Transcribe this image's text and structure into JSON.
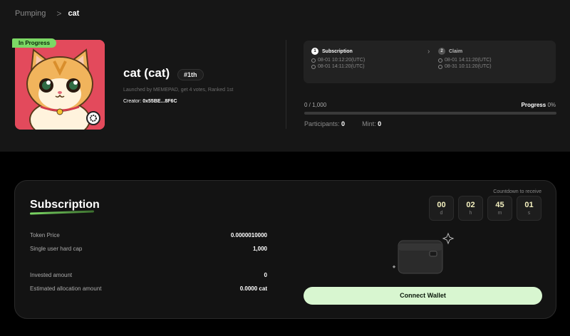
{
  "breadcrumb": {
    "parent": "Pumping",
    "separator": ">",
    "current": "cat"
  },
  "token": {
    "status_badge": "In Progress",
    "title": "cat (cat)",
    "rank": "#1th",
    "launched_text": "Launched by MEMEPAD, get 4 votes, Ranked 1st",
    "creator_label": "Creator:",
    "creator_address": "0x55BE...8F6C"
  },
  "steps": [
    {
      "num": "1",
      "label": "Subscription",
      "start": "08-01 10:12:20(UTC)",
      "end": "08-01 14:11:20(UTC)",
      "active": true
    },
    {
      "num": "2",
      "label": "Claim",
      "start": "08-01 14:11:20(UTC)",
      "end": "08-31 10:11:20(UTC)",
      "active": false
    }
  ],
  "progress": {
    "amount_text": "0 / 1,000",
    "label": "Progress",
    "percent_text": "0%",
    "percent": 0,
    "participants_label": "Participants:",
    "participants": "0",
    "mint_label": "Mint:",
    "mint": "0"
  },
  "subscription": {
    "title": "Subscription",
    "countdown_label": "Countdown to receive",
    "countdown": [
      {
        "value": "00",
        "unit": "d"
      },
      {
        "value": "02",
        "unit": "h"
      },
      {
        "value": "45",
        "unit": "m"
      },
      {
        "value": "01",
        "unit": "s"
      }
    ],
    "rows": [
      {
        "key": "Token Price",
        "value": "0.0000010000"
      },
      {
        "key": "Single user hard cap",
        "value": "1,000"
      },
      {
        "key": "Invested amount",
        "value": "0"
      },
      {
        "key": "Estimated allocation amount",
        "value": "0.0000 cat"
      }
    ],
    "connect_label": "Connect Wallet"
  },
  "colors": {
    "accent": "#7cd865",
    "avatar_bg": "#e34a5c",
    "button_bg": "#d8f6d0",
    "countdown_text": "#f4f1c0"
  },
  "icons": [
    "chevron-right-icon",
    "clock-icon",
    "wallet-illustration",
    "sparkle-icon"
  ]
}
